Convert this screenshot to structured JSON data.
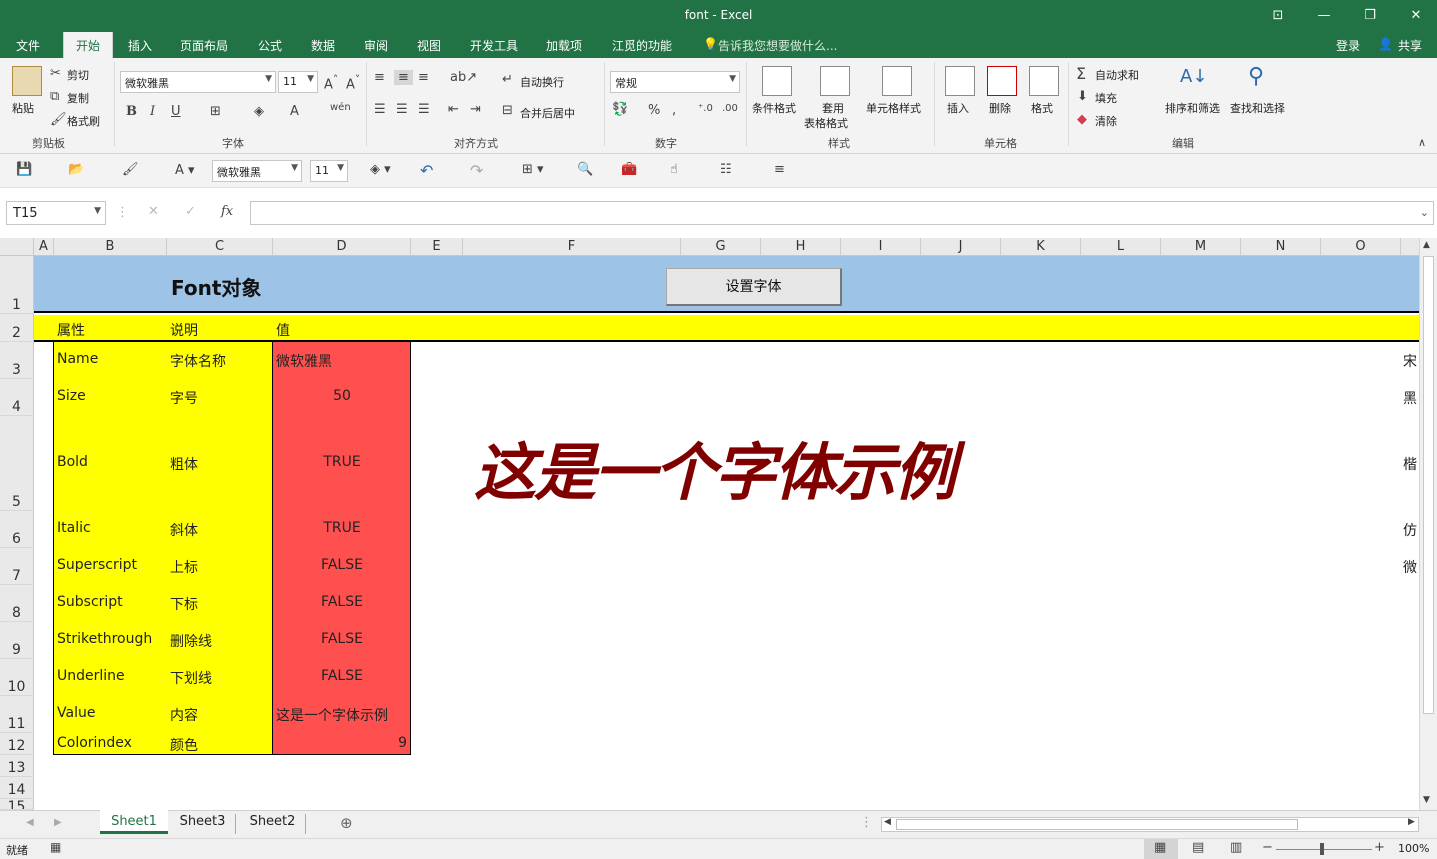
{
  "window": {
    "title": "font - Excel",
    "controls": [
      "⊡",
      "—",
      "❐",
      "✕"
    ]
  },
  "menu": {
    "tabs": [
      "文件",
      "开始",
      "插入",
      "页面布局",
      "公式",
      "数据",
      "审阅",
      "视图",
      "开发工具",
      "加载项",
      "江觅的功能"
    ],
    "active": "开始",
    "search": "告诉我您想要做什么...",
    "login": "登录",
    "share": "共享"
  },
  "ribbon": {
    "clipboard": {
      "paste": "粘贴",
      "cut": "剪切",
      "copy": "复制",
      "painter": "格式刷",
      "label": "剪贴板"
    },
    "font": {
      "name": "微软雅黑",
      "size": "11",
      "label": "字体",
      "bold": "B",
      "italic": "I",
      "underline": "U"
    },
    "align": {
      "wrap": "自动换行",
      "merge": "合并后居中",
      "label": "对齐方式"
    },
    "number": {
      "format": "常规",
      "label": "数字"
    },
    "styles": {
      "cond": "条件格式",
      "table1": "套用",
      "table2": "表格格式",
      "cell": "单元格样式",
      "label": "样式"
    },
    "cells": {
      "insert": "插入",
      "delete": "删除",
      "format": "格式",
      "label": "单元格"
    },
    "editing": {
      "autosum": "自动求和",
      "fill": "填充",
      "clear": "清除",
      "sort": "排序和筛选",
      "find": "查找和选择",
      "label": "编辑"
    }
  },
  "qat": {
    "font": "微软雅黑",
    "size": "11"
  },
  "formula_bar": {
    "name_box": "T15",
    "fx": "fx",
    "value": ""
  },
  "columns": [
    "A",
    "B",
    "C",
    "D",
    "E",
    "F",
    "G",
    "H",
    "I",
    "J",
    "K",
    "L",
    "M",
    "N",
    "O"
  ],
  "rows": [
    "1",
    "2",
    "3",
    "4",
    "5",
    "6",
    "7",
    "8",
    "9",
    "10",
    "11",
    "12",
    "13",
    "14",
    "15"
  ],
  "sheet": {
    "title": "Font对象",
    "button": "设置字体",
    "headers": [
      "属性",
      "说明",
      "值"
    ],
    "table": [
      {
        "prop": "Name",
        "desc": "字体名称",
        "val": "微软雅黑"
      },
      {
        "prop": "Size",
        "desc": "字号",
        "val": "50"
      },
      {
        "prop": "Bold",
        "desc": "粗体",
        "val": "TRUE"
      },
      {
        "prop": "Italic",
        "desc": "斜体",
        "val": "TRUE"
      },
      {
        "prop": "Superscript",
        "desc": "上标",
        "val": "FALSE"
      },
      {
        "prop": "Subscript",
        "desc": "下标",
        "val": "FALSE"
      },
      {
        "prop": "Strikethrough",
        "desc": "删除线",
        "val": "FALSE"
      },
      {
        "prop": "Underline",
        "desc": "下划线",
        "val": "FALSE"
      },
      {
        "prop": "Value",
        "desc": "内容",
        "val": "这是一个字体示例"
      },
      {
        "prop": "Colorindex",
        "desc": "颜色",
        "val": "9"
      }
    ],
    "sample": "这是一个字体示例",
    "sidelist": [
      "宋",
      "黑",
      "楷",
      "仿",
      "微"
    ]
  },
  "sheets": {
    "tabs": [
      "Sheet1",
      "Sheet3",
      "Sheet2"
    ],
    "active": "Sheet1"
  },
  "status": {
    "ready": "就绪",
    "zoom": "100%"
  },
  "colors": {
    "excel_green": "#217346",
    "header_blue": "#9dc3e6",
    "yellow": "#ffff00",
    "red": "#ff5050",
    "sample": "#800000"
  }
}
